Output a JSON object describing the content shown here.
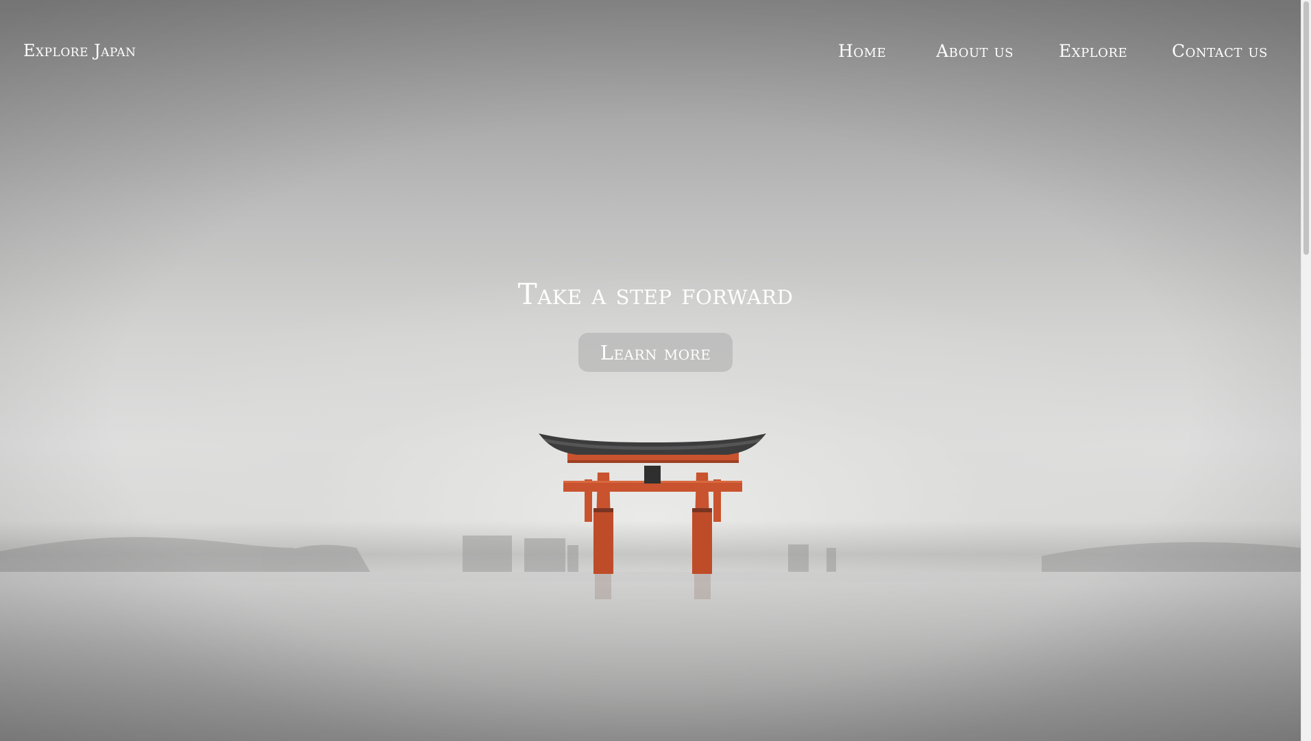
{
  "navbar": {
    "brand": "Explore Japan",
    "links": [
      "Home",
      "About us",
      "Explore",
      "Contact us"
    ]
  },
  "hero": {
    "headline": "Take a step forward",
    "cta_label": "Learn more",
    "image_subject": "torii-gate-in-misty-water"
  },
  "colors": {
    "torii_red": "#c8532e",
    "roof_dark": "#3a3a3a",
    "text": "#ffffff",
    "button_bg": "#b9b9b9"
  }
}
